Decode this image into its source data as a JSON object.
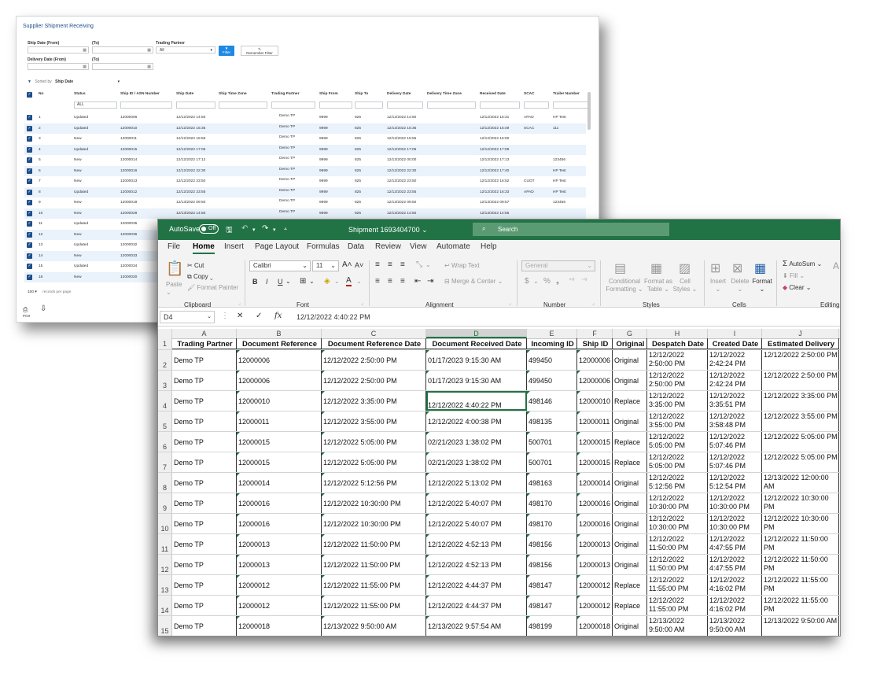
{
  "webapp": {
    "title": "Supplier Shipment Receiving",
    "filters": {
      "ship_date_from": "Ship Date (From)",
      "ship_date_to": "(To)",
      "trading_partner": "Trading Partner",
      "trading_partner_value": "All",
      "delivery_date_from": "Delivery Date (From)",
      "delivery_date_to": "(To)",
      "filter_button": "Filter",
      "remember_button": "Remember Filter"
    },
    "sorted_by_label": "Sorted by",
    "sorted_by_value": "Ship Date",
    "columns": [
      "No",
      "Status",
      "Ship ID / ASN Number",
      "Ship Date",
      "Ship Time Zone",
      "Trading Partner",
      "Ship From",
      "Ship To",
      "Delivery Date",
      "Delivery Time Zone",
      "Received Date",
      "SCAC",
      "Trailer Number"
    ],
    "status_filter": "ALL",
    "rows": [
      {
        "no": "1",
        "status": "Updated",
        "ship_id": "12000006",
        "ship_date": "12/12/2022 14:50",
        "tp": "Demo TP",
        "from": "9999",
        "to": "825",
        "delivery": "12/12/2022 14:50",
        "received": "12/12/2022 15:31",
        "scac": "APAD",
        "trailer": "HP Test"
      },
      {
        "no": "2",
        "status": "Updated",
        "ship_id": "12000010",
        "ship_date": "12/12/2022 15:35",
        "tp": "Demo TP",
        "from": "9999",
        "to": "825",
        "delivery": "12/12/2022 15:35",
        "received": "12/12/2022 15:49",
        "scac": "SCAC",
        "trailer": "111"
      },
      {
        "no": "3",
        "status": "New",
        "ship_id": "12000011",
        "ship_date": "12/12/2022 15:55",
        "tp": "Demo TP",
        "from": "9999",
        "to": "825",
        "delivery": "12/12/2022 15:55",
        "received": "12/12/2022 16:00",
        "scac": "",
        "trailer": ""
      },
      {
        "no": "4",
        "status": "Updated",
        "ship_id": "12000015",
        "ship_date": "12/12/2022 17:05",
        "tp": "Demo TP",
        "from": "9999",
        "to": "825",
        "delivery": "12/12/2022 17:05",
        "received": "12/12/2022 17:09",
        "scac": "",
        "trailer": ""
      },
      {
        "no": "5",
        "status": "New",
        "ship_id": "12000014",
        "ship_date": "12/12/2022 17:12",
        "tp": "Demo TP",
        "from": "9999",
        "to": "825",
        "delivery": "12/13/2022 00:00",
        "received": "12/12/2022 17:13",
        "scac": "",
        "trailer": "123456"
      },
      {
        "no": "6",
        "status": "New",
        "ship_id": "12000016",
        "ship_date": "12/12/2022 22:30",
        "tp": "Demo TP",
        "from": "9999",
        "to": "825",
        "delivery": "12/12/2022 22:30",
        "received": "12/12/2022 17:40",
        "scac": "",
        "trailer": "HP Test"
      },
      {
        "no": "7",
        "status": "New",
        "ship_id": "12000013",
        "ship_date": "12/12/2022 23:50",
        "tp": "Demo TP",
        "from": "9999",
        "to": "825",
        "delivery": "12/12/2022 23:50",
        "received": "12/12/2022 16:52",
        "scac": "CUOT",
        "trailer": "HP Test"
      },
      {
        "no": "8",
        "status": "Updated",
        "ship_id": "12000012",
        "ship_date": "12/12/2022 23:55",
        "tp": "Demo TP",
        "from": "9999",
        "to": "825",
        "delivery": "12/12/2022 23:55",
        "received": "12/12/2022 16:33",
        "scac": "APAD",
        "trailer": "HP Test"
      },
      {
        "no": "9",
        "status": "New",
        "ship_id": "12000018",
        "ship_date": "12/13/2022 09:50",
        "tp": "Demo TP",
        "from": "9999",
        "to": "825",
        "delivery": "12/13/2022 09:50",
        "received": "12/13/2022 09:57",
        "scac": "",
        "trailer": "123456"
      },
      {
        "no": "10",
        "status": "New",
        "ship_id": "12000028",
        "ship_date": "12/13/2022 14:50",
        "tp": "Demo TP",
        "from": "9999",
        "to": "825",
        "delivery": "12/13/2022 14:50",
        "received": "12/13/2022 14:55",
        "scac": "",
        "trailer": ""
      },
      {
        "no": "11",
        "status": "Updated",
        "ship_id": "12000035",
        "ship_date": "",
        "tp": "",
        "from": "",
        "to": "",
        "delivery": "",
        "received": "",
        "scac": "",
        "trailer": ""
      },
      {
        "no": "12",
        "status": "New",
        "ship_id": "12000036",
        "ship_date": "",
        "tp": "",
        "from": "",
        "to": "",
        "delivery": "",
        "received": "",
        "scac": "",
        "trailer": ""
      },
      {
        "no": "13",
        "status": "Updated",
        "ship_id": "12000032",
        "ship_date": "",
        "tp": "",
        "from": "",
        "to": "",
        "delivery": "",
        "received": "",
        "scac": "",
        "trailer": ""
      },
      {
        "no": "14",
        "status": "New",
        "ship_id": "12000033",
        "ship_date": "",
        "tp": "",
        "from": "",
        "to": "",
        "delivery": "",
        "received": "",
        "scac": "",
        "trailer": ""
      },
      {
        "no": "15",
        "status": "Updated",
        "ship_id": "12000034",
        "ship_date": "",
        "tp": "",
        "from": "",
        "to": "",
        "delivery": "",
        "received": "",
        "scac": "",
        "trailer": ""
      },
      {
        "no": "16",
        "status": "New",
        "ship_id": "12000020",
        "ship_date": "",
        "tp": "",
        "from": "",
        "to": "",
        "delivery": "",
        "received": "",
        "scac": "",
        "trailer": ""
      }
    ],
    "page_size": "100",
    "page_size_label": "records per page",
    "print_label": "Print"
  },
  "excel": {
    "autosave": "AutoSave",
    "autosave_state": "Off",
    "title": "Shipment 1693404700",
    "search_placeholder": "Search",
    "menu": [
      "File",
      "Home",
      "Insert",
      "Page Layout",
      "Formulas",
      "Data",
      "Review",
      "View",
      "Automate",
      "Help"
    ],
    "ribbon": {
      "paste": "Paste",
      "cut": "Cut",
      "copy": "Copy",
      "format_painter": "Format Painter",
      "clipboard": "Clipboard",
      "font_name": "Calibri",
      "font_size": "11",
      "font": "Font",
      "wrap_text": "Wrap Text",
      "merge_center": "Merge & Center",
      "alignment": "Alignment",
      "number_format": "General",
      "number": "Number",
      "conditional_formatting": "Conditional Formatting",
      "format_as_table": "Format as Table",
      "cell_styles": "Cell Styles",
      "styles": "Styles",
      "insert": "Insert",
      "delete": "Delete",
      "format": "Format",
      "cells": "Cells",
      "autosum": "AutoSum",
      "fill": "Fill",
      "clear": "Clear",
      "editing": "Editing"
    },
    "name_box": "D4",
    "formula_value": "12/12/2022 4:40:22 PM",
    "col_letters": [
      "A",
      "B",
      "C",
      "D",
      "E",
      "F",
      "G",
      "H",
      "I",
      "J"
    ],
    "headers": [
      "Trading Partner",
      "Document Reference",
      "Document Reference Date",
      "Document Received Date",
      "Incoming ID",
      "Ship ID",
      "Original",
      "Despatch Date",
      "Created Date",
      "Estimated Delivery"
    ],
    "rows": [
      [
        "Demo TP",
        "12000006",
        "12/12/2022 2:50:00 PM",
        "01/17/2023 9:15:30 AM",
        "499450",
        "12000006",
        "Original",
        "12/12/2022 2:50:00 PM",
        "12/12/2022 2:42:24 PM",
        "12/12/2022 2:50:00 PM"
      ],
      [
        "Demo TP",
        "12000006",
        "12/12/2022 2:50:00 PM",
        "01/17/2023 9:15:30 AM",
        "499450",
        "12000006",
        "Original",
        "12/12/2022 2:50:00 PM",
        "12/12/2022 2:42:24 PM",
        "12/12/2022 2:50:00 PM"
      ],
      [
        "Demo TP",
        "12000010",
        "12/12/2022 3:35:00 PM",
        "12/12/2022 4:40:22 PM",
        "498146",
        "12000010",
        "Replace",
        "12/12/2022 3:35:00 PM",
        "12/12/2022 3:35:51 PM",
        "12/12/2022 3:35:00 PM"
      ],
      [
        "Demo TP",
        "12000011",
        "12/12/2022 3:55:00 PM",
        "12/12/2022 4:00:38 PM",
        "498135",
        "12000011",
        "Original",
        "12/12/2022 3:55:00 PM",
        "12/12/2022 3:58:48 PM",
        "12/12/2022 3:55:00 PM"
      ],
      [
        "Demo TP",
        "12000015",
        "12/12/2022 5:05:00 PM",
        "02/21/2023 1:38:02 PM",
        "500701",
        "12000015",
        "Replace",
        "12/12/2022 5:05:00 PM",
        "12/12/2022 5:07:46 PM",
        "12/12/2022 5:05:00 PM"
      ],
      [
        "Demo TP",
        "12000015",
        "12/12/2022 5:05:00 PM",
        "02/21/2023 1:38:02 PM",
        "500701",
        "12000015",
        "Replace",
        "12/12/2022 5:05:00 PM",
        "12/12/2022 5:07:46 PM",
        "12/12/2022 5:05:00 PM"
      ],
      [
        "Demo TP",
        "12000014",
        "12/12/2022 5:12:56 PM",
        "12/12/2022 5:13:02 PM",
        "498163",
        "12000014",
        "Original",
        "12/12/2022 5:12:56 PM",
        "12/12/2022 5:12:54 PM",
        "12/13/2022 12:00:00 AM"
      ],
      [
        "Demo TP",
        "12000016",
        "12/12/2022 10:30:00 PM",
        "12/12/2022 5:40:07 PM",
        "498170",
        "12000016",
        "Original",
        "12/12/2022 10:30:00 PM",
        "12/12/2022 10:30:00 PM",
        "12/12/2022 10:30:00 PM"
      ],
      [
        "Demo TP",
        "12000016",
        "12/12/2022 10:30:00 PM",
        "12/12/2022 5:40:07 PM",
        "498170",
        "12000016",
        "Original",
        "12/12/2022 10:30:00 PM",
        "12/12/2022 10:30:00 PM",
        "12/12/2022 10:30:00 PM"
      ],
      [
        "Demo TP",
        "12000013",
        "12/12/2022 11:50:00 PM",
        "12/12/2022 4:52:13 PM",
        "498156",
        "12000013",
        "Original",
        "12/12/2022 11:50:00 PM",
        "12/12/2022 4:47:55 PM",
        "12/12/2022 11:50:00 PM"
      ],
      [
        "Demo TP",
        "12000013",
        "12/12/2022 11:50:00 PM",
        "12/12/2022 4:52:13 PM",
        "498156",
        "12000013",
        "Original",
        "12/12/2022 11:50:00 PM",
        "12/12/2022 4:47:55 PM",
        "12/12/2022 11:50:00 PM"
      ],
      [
        "Demo TP",
        "12000012",
        "12/12/2022 11:55:00 PM",
        "12/12/2022 4:44:37 PM",
        "498147",
        "12000012",
        "Replace",
        "12/12/2022 11:55:00 PM",
        "12/12/2022 4:16:02 PM",
        "12/12/2022 11:55:00 PM"
      ],
      [
        "Demo TP",
        "12000012",
        "12/12/2022 11:55:00 PM",
        "12/12/2022 4:44:37 PM",
        "498147",
        "12000012",
        "Replace",
        "12/12/2022 11:55:00 PM",
        "12/12/2022 4:16:02 PM",
        "12/12/2022 11:55:00 PM"
      ],
      [
        "Demo TP",
        "12000018",
        "12/13/2022 9:50:00 AM",
        "12/13/2022 9:57:54 AM",
        "498199",
        "12000018",
        "Original",
        "12/13/2022 9:50:00 AM",
        "12/13/2022 9:50:00 AM",
        "12/13/2022 9:50:00 AM"
      ]
    ],
    "row_numbers": [
      "1",
      "2",
      "3",
      "4",
      "5",
      "6",
      "7",
      "8",
      "9",
      "10",
      "11",
      "12",
      "13",
      "14",
      "15"
    ]
  }
}
